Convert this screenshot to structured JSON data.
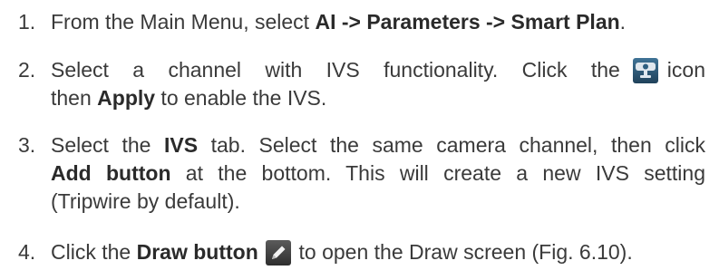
{
  "steps": [
    {
      "number": "1.",
      "text_1": "From the Main Menu, select ",
      "bold_1": "AI -> Parameters -> Smart Plan",
      "text_2": "."
    },
    {
      "number": "2.",
      "text_1": "Select a channel with IVS functionality. Click the",
      "icon": "ivs-camera-icon",
      "text_2": "icon",
      "text_3": "then ",
      "bold_1": "Apply",
      "text_4": " to enable the IVS."
    },
    {
      "number": "3.",
      "text_1": "Select the ",
      "bold_1": "IVS",
      "text_2": " tab. Select the same camera channel, then click",
      "bold_2": "Add button",
      "text_3": " at the bottom. This will create a new IVS setting",
      "text_4": "(Tripwire by default)."
    },
    {
      "number": "4.",
      "text_1": "Click the ",
      "bold_1": "Draw button",
      "icon": "pencil-icon",
      "text_2": " to open the Draw screen (Fig. 6.10)."
    }
  ],
  "colors": {
    "text": "#3a3a3a",
    "ivs_icon_bg": "#2f5f80",
    "draw_icon_bg": "#444444"
  }
}
